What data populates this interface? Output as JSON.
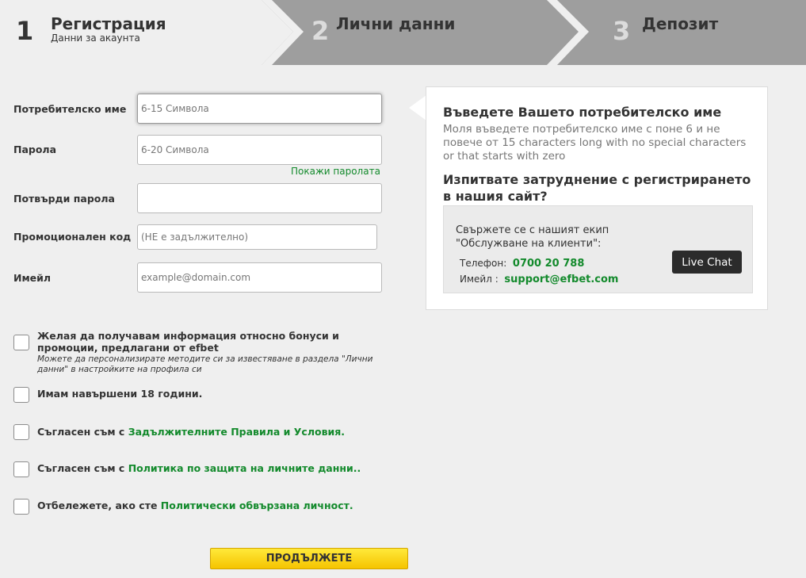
{
  "steps": [
    {
      "number": "1",
      "title": "Регистрация",
      "subtitle": "Данни за акаунта"
    },
    {
      "number": "2",
      "title": "Лични данни"
    },
    {
      "number": "3",
      "title": "Депозит"
    }
  ],
  "form": {
    "username": {
      "label": "Потребителско име",
      "placeholder": "6-15 Символа",
      "value": ""
    },
    "password": {
      "label": "Парола",
      "placeholder": "6-20 Символа",
      "value": ""
    },
    "show_password": "Покажи паролата",
    "confirm": {
      "label": "Потвърди парола",
      "placeholder": "",
      "value": ""
    },
    "promo": {
      "label": "Промоционален код",
      "placeholder": "(НЕ е задължително)",
      "value": ""
    },
    "email": {
      "label": "Имейл",
      "placeholder": "example@domain.com",
      "value": ""
    }
  },
  "checkboxes": {
    "bonus": {
      "text": "Желая да получавам информация относно бонуси и промоции, предлагани от efbet",
      "note": "Можете да персонализирате методите си за известяване в раздела \"Лични данни\" в настройките на профила си"
    },
    "age": {
      "text": "Имам навършени 18 години."
    },
    "terms": {
      "prefix": "Съгласен съм с ",
      "link": "Задължителните Правила и Условия."
    },
    "privacy": {
      "prefix": "Съгласен съм с ",
      "link": "Политика по защита на личните данни.."
    },
    "pep": {
      "prefix": "Отбележете, ако сте ",
      "link": "Политически обвързана личност."
    }
  },
  "continue_label": "ПРОДЪЛЖЕТЕ",
  "info": {
    "title": "Въведете Вашето потребителско име",
    "text": "Моля въведете потребителско име с поне 6 и не повече от 15 characters long with no special characters or that starts with zero",
    "question": "Изпитвате затруднение с регистрирането в нашия сайт?",
    "contact_text": "Свържете се с нашият екип \"Обслужване на клиенти\":",
    "phone_label": "Телефон:",
    "phone": "0700 20 788",
    "email_label": "Имейл :",
    "email": "support@efbet.com",
    "live_chat": "Live Chat"
  },
  "colors": {
    "accent_green": "#138a2c",
    "button_yellow": "#ffe93a",
    "step_active": "#efefef",
    "step_inactive": "#a0a0a0"
  }
}
